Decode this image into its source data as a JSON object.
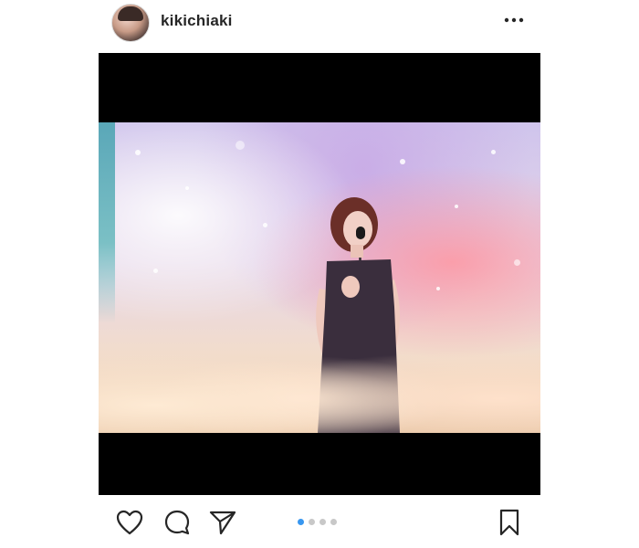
{
  "header": {
    "username": "kikichiaki",
    "avatar_icon": "profile-avatar",
    "more_icon": "more-options-icon"
  },
  "post": {
    "photo_icon": "concert-photo",
    "carousel": {
      "total": 4,
      "active_index": 0,
      "active_color": "#3897f0",
      "inactive_color": "#c8c8c8"
    }
  },
  "actions": {
    "like_icon": "heart-icon",
    "comment_icon": "comment-icon",
    "share_icon": "send-icon",
    "save_icon": "bookmark-icon"
  }
}
